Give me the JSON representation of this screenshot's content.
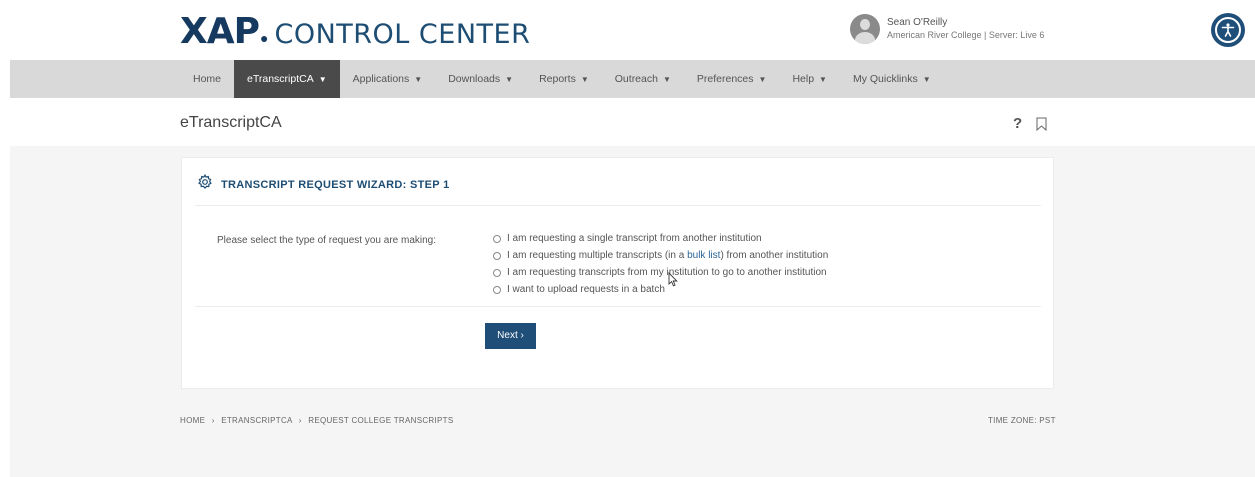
{
  "header": {
    "logo_main": "XAP",
    "logo_dot": "●",
    "logo_sub": "CONTROL CENTER",
    "user_name": "Sean O'Reilly",
    "user_org": "American River College | Server: Live 6"
  },
  "nav": {
    "items": [
      {
        "label": "Home",
        "caret": ""
      },
      {
        "label": "eTranscriptCA",
        "caret": "▼"
      },
      {
        "label": "Applications",
        "caret": "▼"
      },
      {
        "label": "Downloads",
        "caret": "▼"
      },
      {
        "label": "Reports",
        "caret": "▼"
      },
      {
        "label": "Outreach",
        "caret": "▼"
      },
      {
        "label": "Preferences",
        "caret": "▼"
      },
      {
        "label": "Help",
        "caret": "▼"
      },
      {
        "label": "My Quicklinks",
        "caret": "▼"
      }
    ],
    "active_index": 1
  },
  "page": {
    "title": "eTranscriptCA",
    "help_glyph": "?"
  },
  "wizard": {
    "title": "TRANSCRIPT REQUEST WIZARD: STEP 1",
    "prompt": "Please select the type of request you are making:",
    "options": [
      {
        "text": "I am requesting a single transcript from another institution"
      },
      {
        "pre": "I am requesting multiple transcripts (in a ",
        "link": "bulk list",
        "post": ") from another institution"
      },
      {
        "text": "I am requesting transcripts from my institution to go to another institution"
      },
      {
        "text": "I want to upload requests in a batch"
      }
    ],
    "next_label": "Next ›"
  },
  "footer": {
    "breadcrumb": [
      "HOME",
      "ETRANSCRIPTCA",
      "REQUEST COLLEGE TRANSCRIPTS"
    ],
    "separator": "›",
    "timezone": "TIME ZONE: PST"
  },
  "colors": {
    "brand": "#163a5f",
    "nav_active": "#4a4a4a",
    "button": "#1f4e79"
  }
}
